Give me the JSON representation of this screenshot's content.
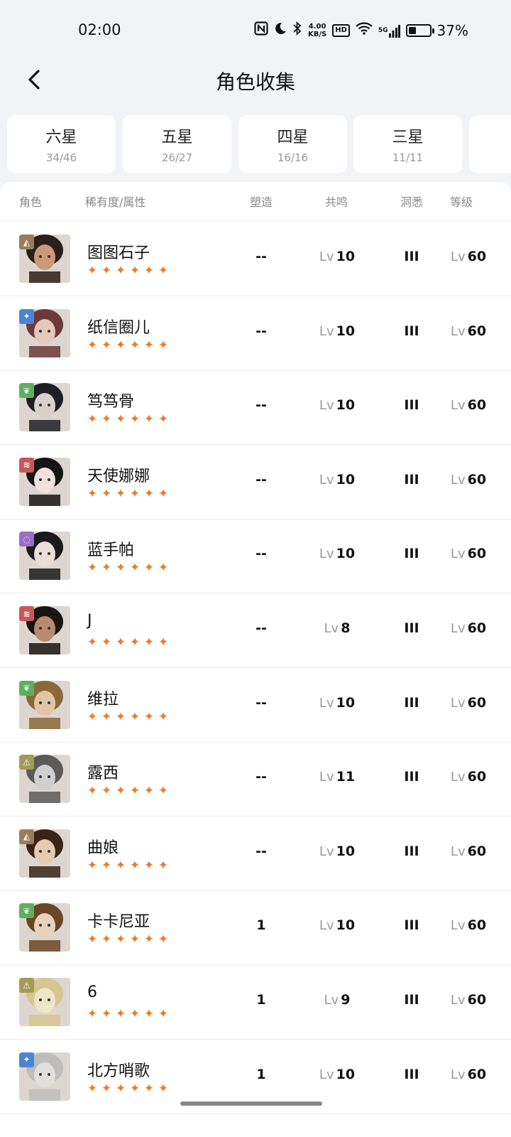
{
  "status": {
    "time": "02:00",
    "net_speed_value": "4.00",
    "net_speed_unit": "KB/S",
    "hd": "HD",
    "network": "5G",
    "battery_pct": "37%",
    "battery_level": 0.37
  },
  "header": {
    "title": "角色收集"
  },
  "tabs": [
    {
      "label": "六星",
      "count": "34/46"
    },
    {
      "label": "五星",
      "count": "26/27"
    },
    {
      "label": "四星",
      "count": "16/16"
    },
    {
      "label": "三星",
      "count": "11/11"
    }
  ],
  "columns": {
    "role": "角色",
    "rarity": "稀有度/属性",
    "forge": "塑造",
    "resonance": "共鸣",
    "insight": "洞悉",
    "level": "等级"
  },
  "lv_prefix": "Lv",
  "star_glyph": "✦",
  "characters": [
    {
      "name": "图图石子",
      "forge": "--",
      "resonance": "10",
      "insight": "III",
      "level": "60",
      "stars": 6,
      "attr_icon": "mineral-icon",
      "attr_color": "#9a7b5a"
    },
    {
      "name": "纸信圈儿",
      "forge": "--",
      "resonance": "10",
      "insight": "III",
      "level": "60",
      "stars": 6,
      "attr_icon": "star-astral-icon",
      "attr_color": "#4a86d4"
    },
    {
      "name": "笃笃骨",
      "forge": "--",
      "resonance": "10",
      "insight": "III",
      "level": "60",
      "stars": 6,
      "attr_icon": "plant-leaf-icon",
      "attr_color": "#5fae5f"
    },
    {
      "name": "天使娜娜",
      "forge": "--",
      "resonance": "10",
      "insight": "III",
      "level": "60",
      "stars": 6,
      "attr_icon": "beast-claw-icon",
      "attr_color": "#c9575a"
    },
    {
      "name": "蓝手帕",
      "forge": "--",
      "resonance": "10",
      "insight": "III",
      "level": "60",
      "stars": 6,
      "attr_icon": "spirit-icon",
      "attr_color": "#9a6cc4"
    },
    {
      "name": "J",
      "forge": "--",
      "resonance": "8",
      "insight": "III",
      "level": "60",
      "stars": 6,
      "attr_icon": "beast-claw-icon",
      "attr_color": "#c9575a"
    },
    {
      "name": "维拉",
      "forge": "--",
      "resonance": "10",
      "insight": "III",
      "level": "60",
      "stars": 6,
      "attr_icon": "plant-leaf-icon",
      "attr_color": "#5fae5f"
    },
    {
      "name": "露西",
      "forge": "--",
      "resonance": "11",
      "insight": "III",
      "level": "60",
      "stars": 6,
      "attr_icon": "intellect-icon",
      "attr_color": "#a39a5a"
    },
    {
      "name": "曲娘",
      "forge": "--",
      "resonance": "10",
      "insight": "III",
      "level": "60",
      "stars": 6,
      "attr_icon": "mineral-icon",
      "attr_color": "#9a7b5a"
    },
    {
      "name": "卡卡尼亚",
      "forge": "1",
      "resonance": "10",
      "insight": "III",
      "level": "60",
      "stars": 6,
      "attr_icon": "plant-leaf-icon",
      "attr_color": "#5fae5f"
    },
    {
      "name": "6",
      "forge": "1",
      "resonance": "9",
      "insight": "III",
      "level": "60",
      "stars": 6,
      "attr_icon": "intellect-icon",
      "attr_color": "#a39a5a"
    },
    {
      "name": "北方哨歌",
      "forge": "1",
      "resonance": "10",
      "insight": "III",
      "level": "60",
      "stars": 6,
      "attr_icon": "star-astral-icon",
      "attr_color": "#4a86d4"
    }
  ],
  "colors": {
    "accent_star": "#f07a2a",
    "page_bg": "#f2f3f6",
    "card_bg": "#ffffff"
  }
}
